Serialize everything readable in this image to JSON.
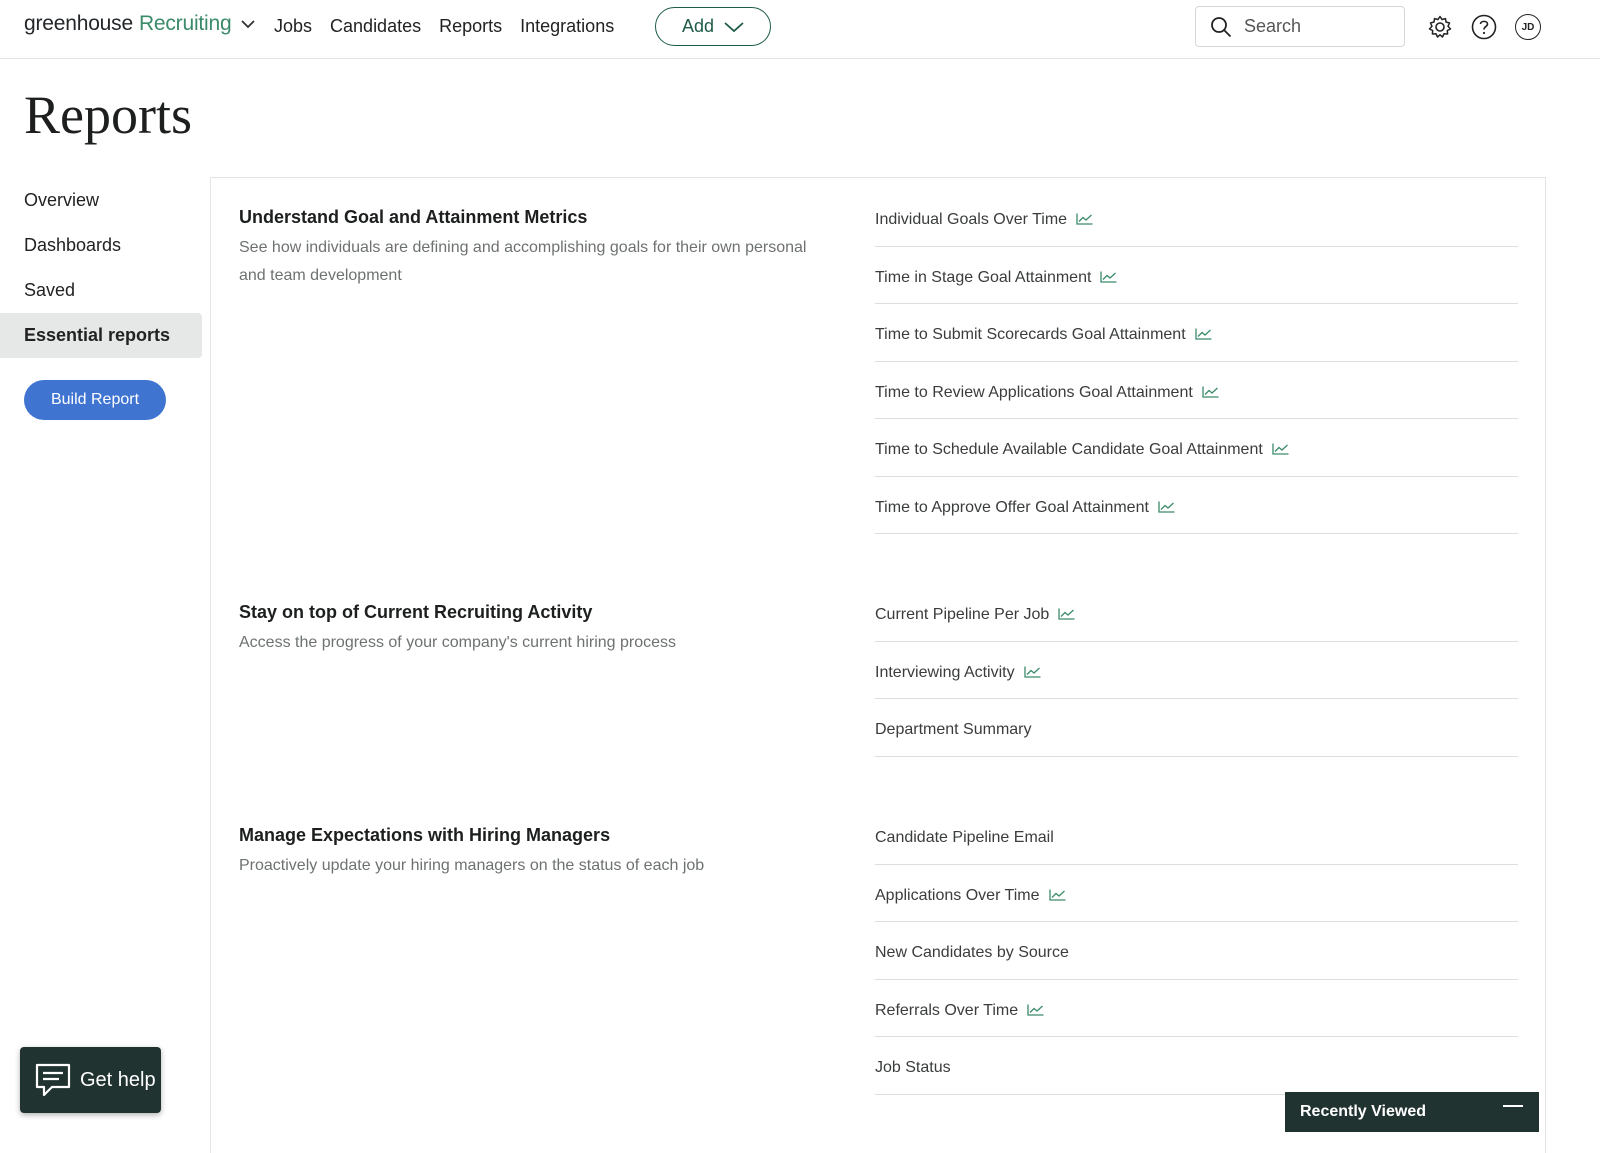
{
  "header": {
    "brand_main": "greenhouse",
    "brand_accent": "Recruiting",
    "nav": [
      "Jobs",
      "Candidates",
      "Reports",
      "Integrations"
    ],
    "add_label": "Add",
    "search_placeholder": "Search",
    "avatar_initials": "JD",
    "icons": [
      "chevron-down-icon",
      "search-icon",
      "gear-icon",
      "help-icon"
    ]
  },
  "page": {
    "title": "Reports"
  },
  "sidebar": {
    "items": [
      {
        "label": "Overview"
      },
      {
        "label": "Dashboards"
      },
      {
        "label": "Saved"
      },
      {
        "label": "Essential reports"
      }
    ],
    "active": "Essential reports",
    "build_button": "Build Report"
  },
  "sections": [
    {
      "title": "Understand Goal and Attainment Metrics",
      "description": "See how individuals are defining and accomplishing goals for their own personal and team development",
      "reports": [
        {
          "label": "Individual Goals Over Time",
          "chart": true
        },
        {
          "label": "Time in Stage Goal Attainment",
          "chart": true
        },
        {
          "label": "Time to Submit Scorecards Goal Attainment",
          "chart": true
        },
        {
          "label": "Time to Review Applications Goal Attainment",
          "chart": true
        },
        {
          "label": "Time to Schedule Available Candidate Goal Attainment",
          "chart": true
        },
        {
          "label": "Time to Approve Offer Goal Attainment",
          "chart": true
        }
      ]
    },
    {
      "title": "Stay on top of Current Recruiting Activity",
      "description": "Access the progress of your company's current hiring process",
      "reports": [
        {
          "label": "Current Pipeline Per Job",
          "chart": true
        },
        {
          "label": "Interviewing Activity",
          "chart": true
        },
        {
          "label": "Department Summary",
          "chart": false
        }
      ]
    },
    {
      "title": "Manage Expectations with Hiring Managers",
      "description": "Proactively update your hiring managers on the status of each job",
      "reports": [
        {
          "label": "Candidate Pipeline Email",
          "chart": false
        },
        {
          "label": "Applications Over Time",
          "chart": true
        },
        {
          "label": "New Candidates by Source",
          "chart": false
        },
        {
          "label": "Referrals Over Time",
          "chart": true
        },
        {
          "label": "Job Status",
          "chart": false
        }
      ]
    }
  ],
  "floating": {
    "get_help": "Get help",
    "recently_viewed": "Recently Viewed"
  },
  "colors": {
    "brand_green": "#3b8a6a",
    "dark_green": "#1f5c46",
    "primary_blue": "#3f74d1",
    "widget_dark": "#213330"
  }
}
